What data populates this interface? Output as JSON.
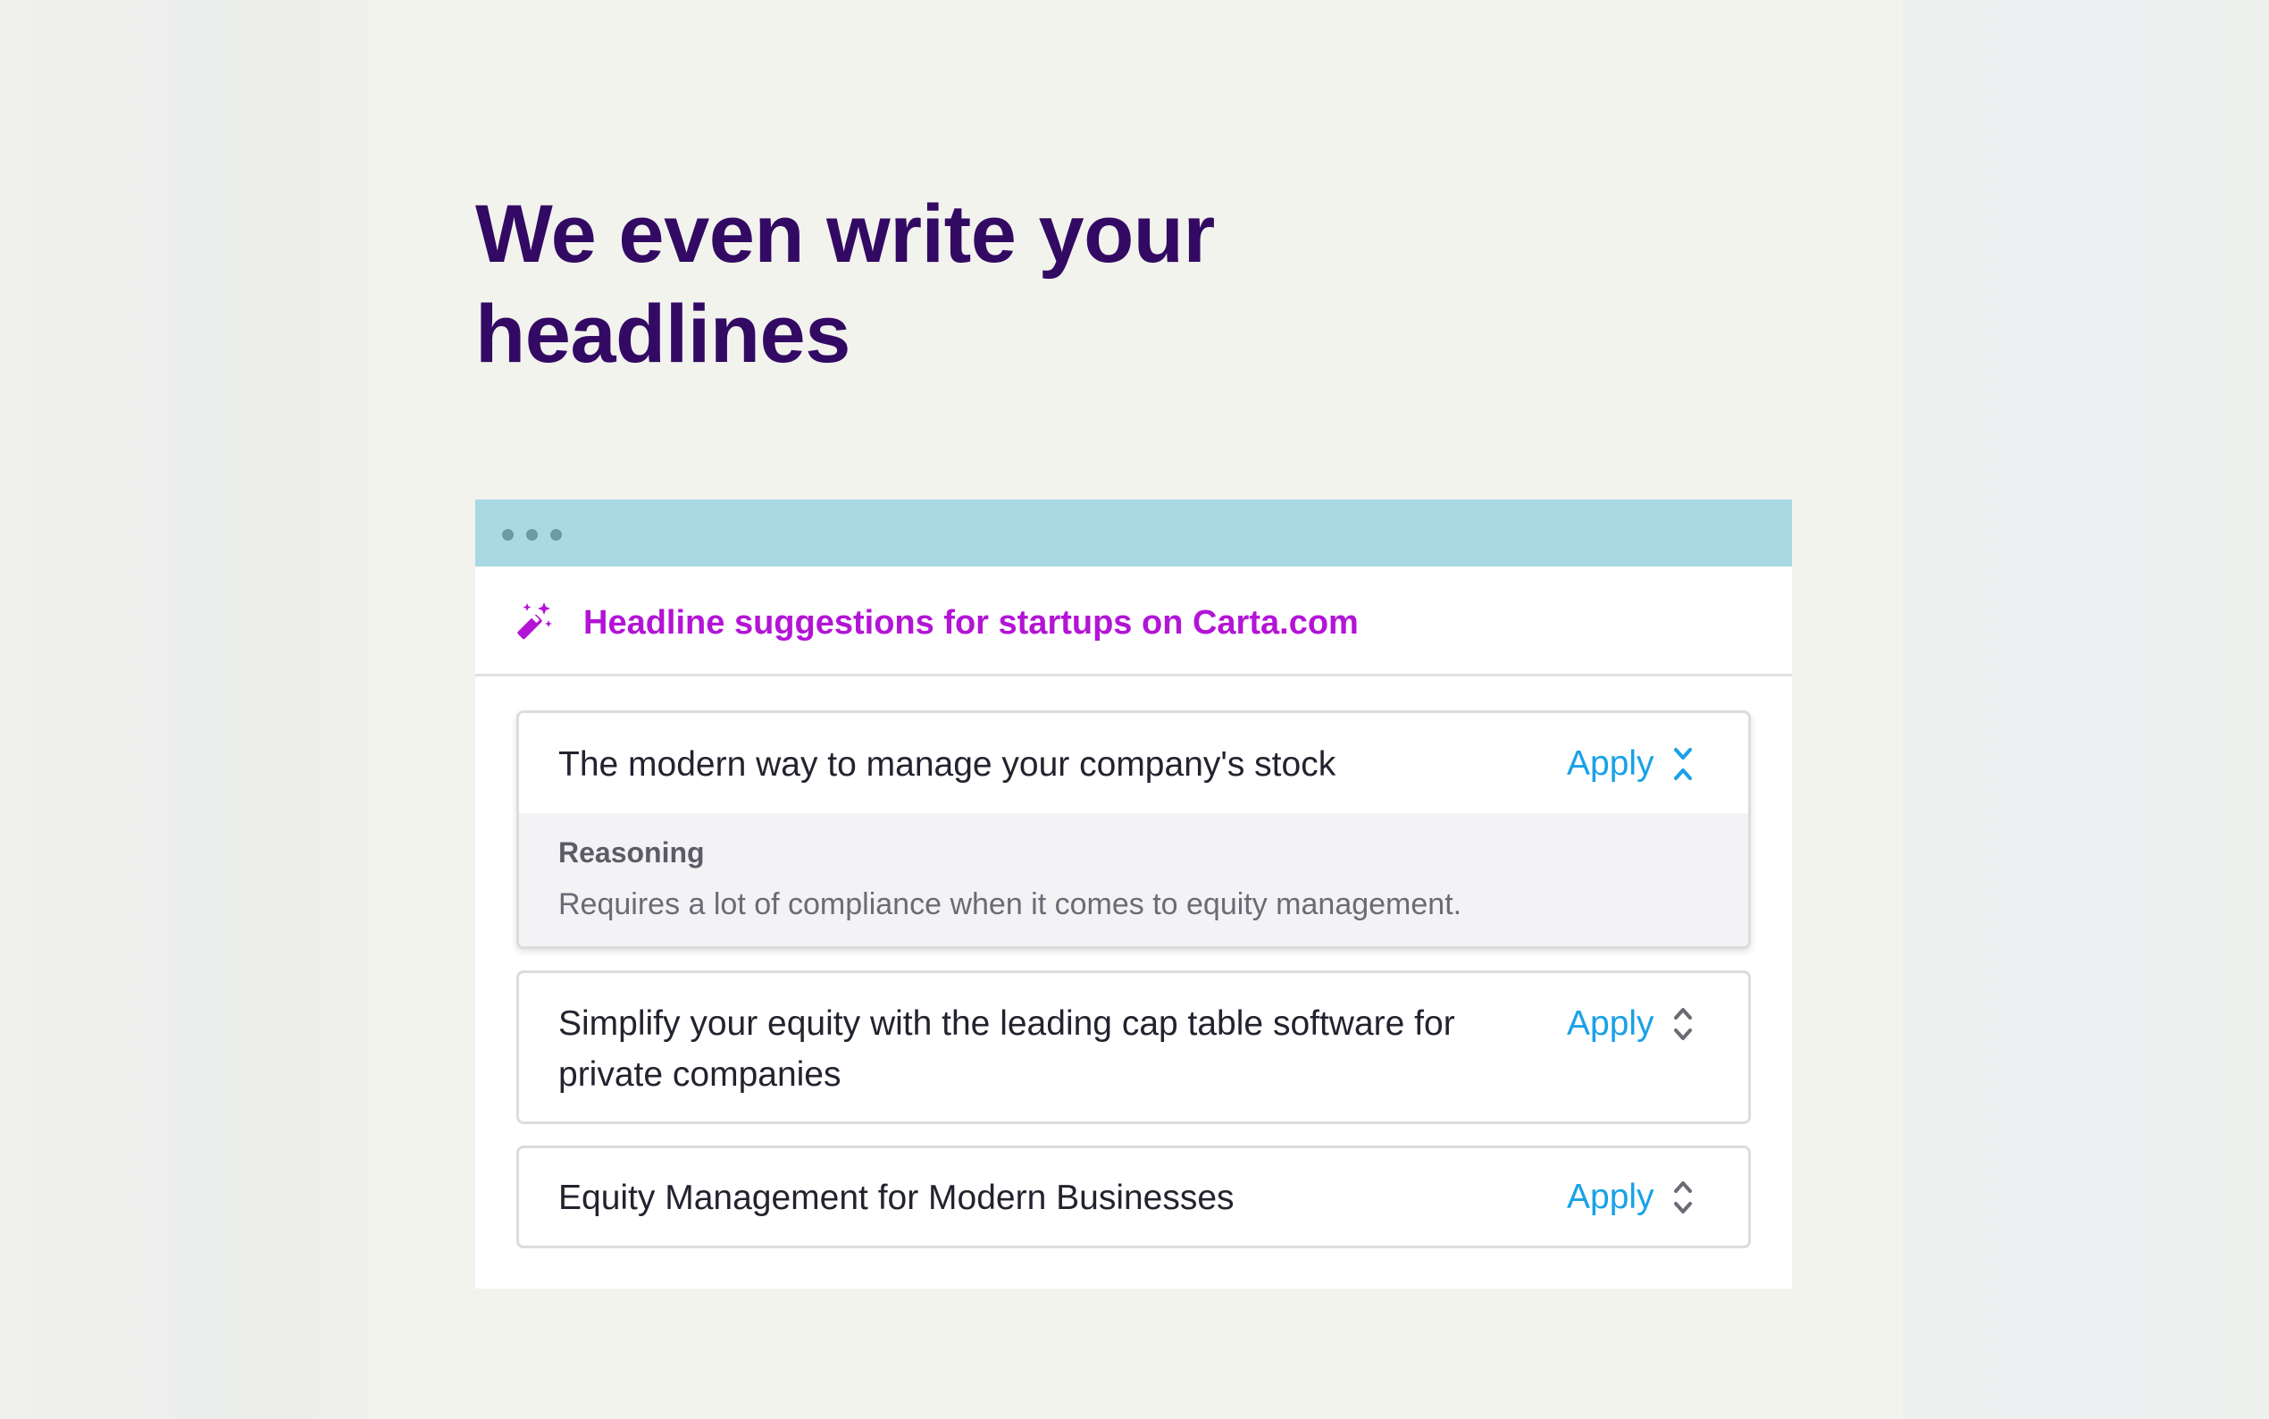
{
  "hero": {
    "headline_line1": "We even write your",
    "headline_line2": "headlines"
  },
  "window": {
    "titlebar_color": "#a9d9e3",
    "dots": [
      "dot",
      "dot",
      "dot"
    ]
  },
  "panel": {
    "icon": "magic-wand-icon",
    "title": "Headline suggestions for startups on Carta.com",
    "title_color": "#b314d6"
  },
  "suggestions": [
    {
      "text": "The modern way to manage your company's stock",
      "apply_label": "Apply",
      "expanded": true,
      "toggle_icon": "collapse-icon",
      "reasoning_label": "Reasoning",
      "reasoning": "Requires a lot of compliance when it comes to equity management."
    },
    {
      "text": "Simplify your equity with the leading cap table software for private companies",
      "apply_label": "Apply",
      "expanded": false,
      "toggle_icon": "expand-icon"
    },
    {
      "text": "Equity Management for Modern Businesses",
      "apply_label": "Apply",
      "expanded": false,
      "toggle_icon": "expand-icon"
    }
  ],
  "colors": {
    "headline": "#330a63",
    "accent": "#19a1e8",
    "page_background": "#f3f3ee"
  }
}
